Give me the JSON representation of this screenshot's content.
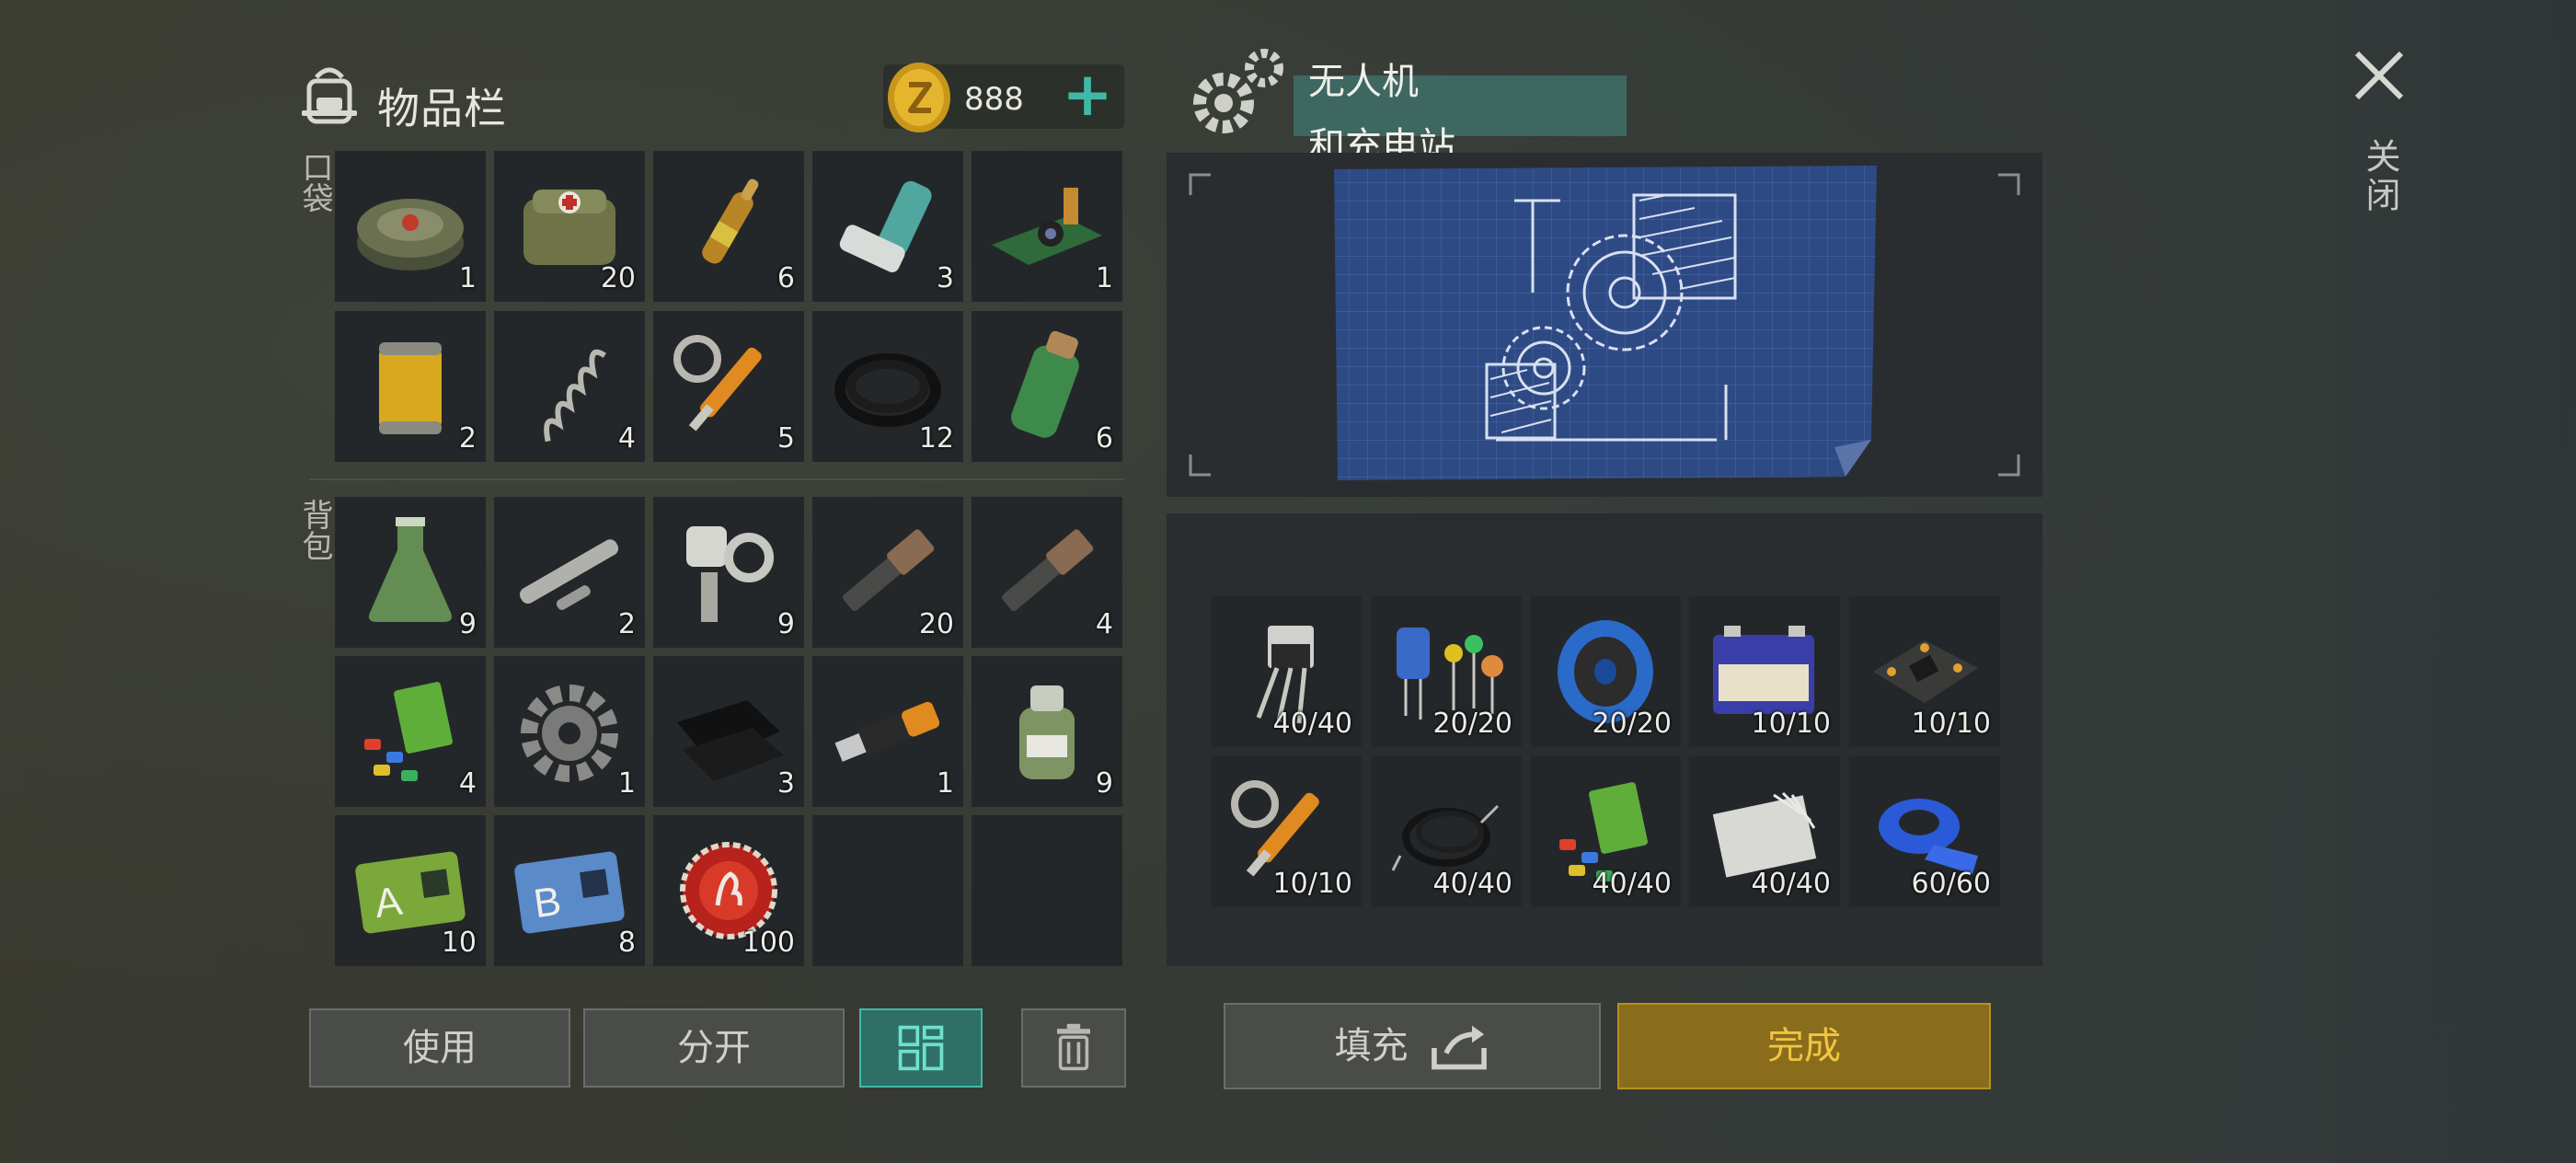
{
  "inventory": {
    "title": "物品栏",
    "currency_value": "888",
    "add_label": "+",
    "pocket_label": "口袋",
    "backpack_label": "背包",
    "pocket_items": [
      {
        "name": "landmine",
        "count": "1"
      },
      {
        "name": "medkit-bag",
        "count": "20"
      },
      {
        "name": "ampoule",
        "count": "6"
      },
      {
        "name": "inhaler",
        "count": "3"
      },
      {
        "name": "camera-module",
        "count": "1"
      },
      {
        "name": "oil-filter",
        "count": "2"
      },
      {
        "name": "spring",
        "count": "4"
      },
      {
        "name": "hydraulic-parts",
        "count": "5"
      },
      {
        "name": "rubber-hose",
        "count": "12"
      },
      {
        "name": "flask-canister",
        "count": "6"
      }
    ],
    "backpack_items": [
      {
        "name": "chemical-flask",
        "count": "9"
      },
      {
        "name": "metal-rods",
        "count": "2"
      },
      {
        "name": "mechanical-parts",
        "count": "9"
      },
      {
        "name": "metal-pipe",
        "count": "20"
      },
      {
        "name": "metal-pipe",
        "count": "4"
      },
      {
        "name": "plastic-parts",
        "count": "4"
      },
      {
        "name": "gear",
        "count": "1"
      },
      {
        "name": "black-fabric",
        "count": "3"
      },
      {
        "name": "usb-stick",
        "count": "1"
      },
      {
        "name": "chemical-jar",
        "count": "9"
      },
      {
        "name": "sector-a-card",
        "count": "10"
      },
      {
        "name": "sector-b-card",
        "count": "8"
      },
      {
        "name": "bottle-cap",
        "count": "100"
      },
      {
        "name": "empty",
        "count": ""
      },
      {
        "name": "empty",
        "count": ""
      }
    ],
    "buttons": {
      "use": "使用",
      "split": "分开"
    }
  },
  "craft": {
    "title_line1": "无人机",
    "title_line2": "和充电站",
    "requirements": [
      {
        "name": "transistor",
        "count": "40/40"
      },
      {
        "name": "capacitors",
        "count": "20/20"
      },
      {
        "name": "wire-spool",
        "count": "20/20"
      },
      {
        "name": "battery",
        "count": "10/10"
      },
      {
        "name": "circuit-board",
        "count": "10/10"
      },
      {
        "name": "hydraulic-parts",
        "count": "10/10"
      },
      {
        "name": "wires",
        "count": "40/40"
      },
      {
        "name": "plastic-parts",
        "count": "40/40"
      },
      {
        "name": "fiberglass",
        "count": "40/40"
      },
      {
        "name": "blue-tape",
        "count": "60/60"
      }
    ],
    "fill_label": "填充",
    "complete_label": "完成"
  },
  "close_label": "关闭",
  "colors": {
    "accent_teal": "#3fb9a6",
    "complete_gold": "#8a6d1c",
    "complete_text": "#f2c542"
  }
}
